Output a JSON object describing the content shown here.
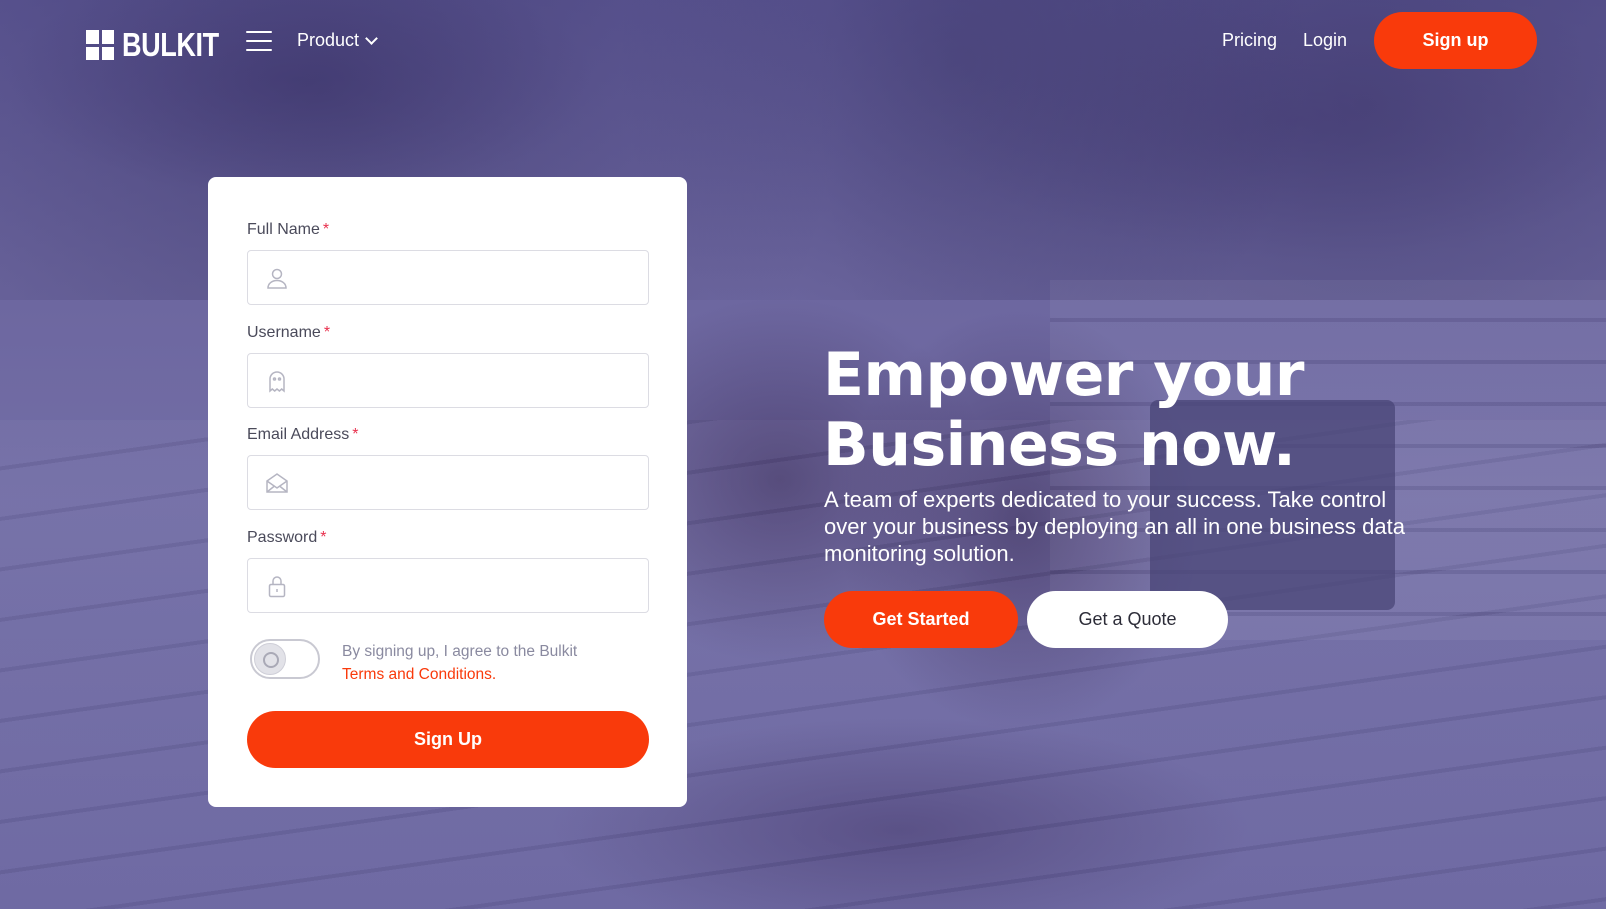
{
  "brand": {
    "name": "BULKIT"
  },
  "nav": {
    "product_label": "Product",
    "pricing_label": "Pricing",
    "login_label": "Login",
    "signup_label": "Sign up"
  },
  "form": {
    "full_name": {
      "label": "Full Name",
      "required_mark": "*",
      "value": "",
      "icon": "user-icon"
    },
    "username": {
      "label": "Username",
      "required_mark": "*",
      "value": "",
      "icon": "ghost-icon"
    },
    "email": {
      "label": "Email Address",
      "required_mark": "*",
      "value": "",
      "icon": "envelope-icon"
    },
    "password": {
      "label": "Password",
      "required_mark": "*",
      "value": "",
      "icon": "lock-icon"
    },
    "terms_toggle_on": false,
    "agree_text": "By signing up, I agree to the Bulkit",
    "terms_link": "Terms and Conditions.",
    "submit_label": "Sign Up"
  },
  "hero": {
    "headline_line1": "Empower your",
    "headline_line2": "Business now.",
    "subtext": "A team of experts dedicated to your success. Take control over your business by deploying an all in one business data monitoring solution.",
    "primary_cta": "Get Started",
    "secondary_cta": "Get a Quote"
  },
  "colors": {
    "accent": "#f93a0b",
    "overlay": "#6c669f",
    "required": "#e8304d"
  }
}
